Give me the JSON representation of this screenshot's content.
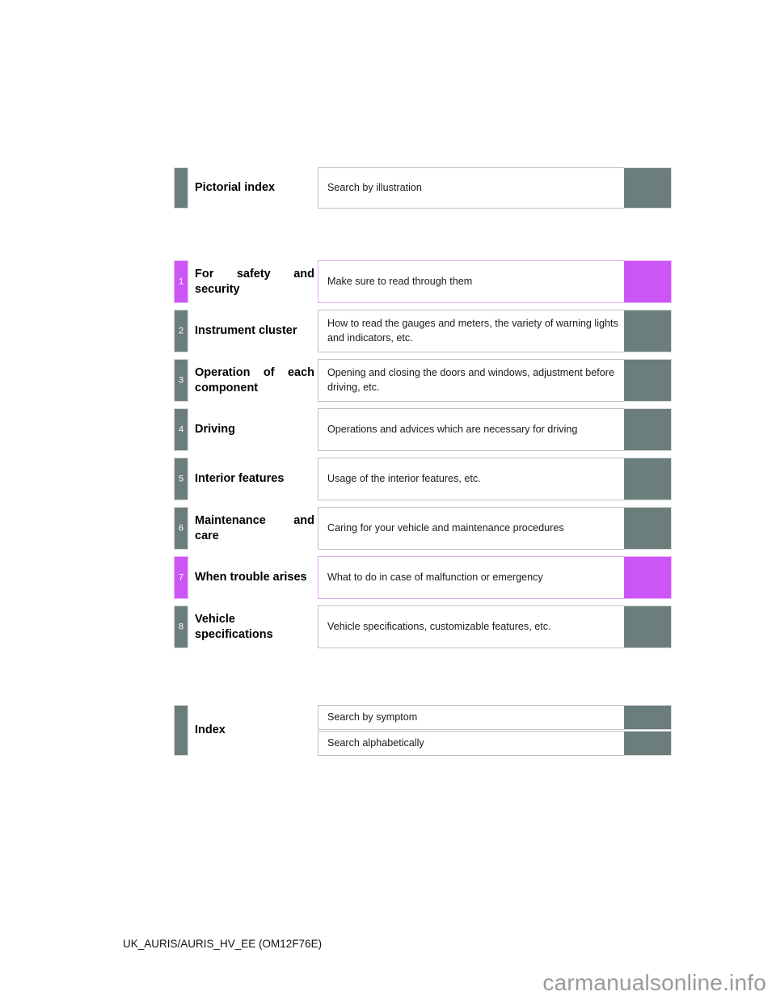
{
  "pictorial": {
    "tab_color": "#6c7e7c",
    "title": "Pictorial index",
    "description": "Search by illustration"
  },
  "chapters": [
    {
      "number": "1",
      "title": "For safety and security",
      "description": "Make sure to read through them",
      "accent": true,
      "color": "#cc55f5"
    },
    {
      "number": "2",
      "title": "Instrument cluster",
      "description": "How to read the gauges and meters, the variety of warning lights and indicators, etc.",
      "accent": false,
      "color": "#6c7e7c"
    },
    {
      "number": "3",
      "title": "Operation of each component",
      "description": "Opening and closing the doors and windows, adjustment before driving, etc.",
      "accent": false,
      "color": "#6c7e7c"
    },
    {
      "number": "4",
      "title": "Driving",
      "description": "Operations and advices which are necessary for driving",
      "accent": false,
      "color": "#6c7e7c"
    },
    {
      "number": "5",
      "title": "Interior features",
      "description": "Usage of the interior features, etc.",
      "accent": false,
      "color": "#6c7e7c"
    },
    {
      "number": "6",
      "title": "Maintenance and care",
      "description": "Caring for your vehicle and maintenance procedures",
      "accent": false,
      "color": "#6c7e7c"
    },
    {
      "number": "7",
      "title": "When trouble arises",
      "description": "What to do in case of malfunction or emergency",
      "accent": true,
      "color": "#cc55f5"
    },
    {
      "number": "8",
      "title": "Vehicle specifications",
      "description": "Vehicle specifications, customizable features, etc.",
      "accent": false,
      "color": "#6c7e7c"
    }
  ],
  "index": {
    "tab_color": "#6c7e7c",
    "title": "Index",
    "entries": [
      {
        "description": "Search by symptom"
      },
      {
        "description": "Search alphabetically"
      }
    ]
  },
  "footer": {
    "code": "UK_AURIS/AURIS_HV_EE (OM12F76E)",
    "watermark": "carmanualsonline.info"
  }
}
